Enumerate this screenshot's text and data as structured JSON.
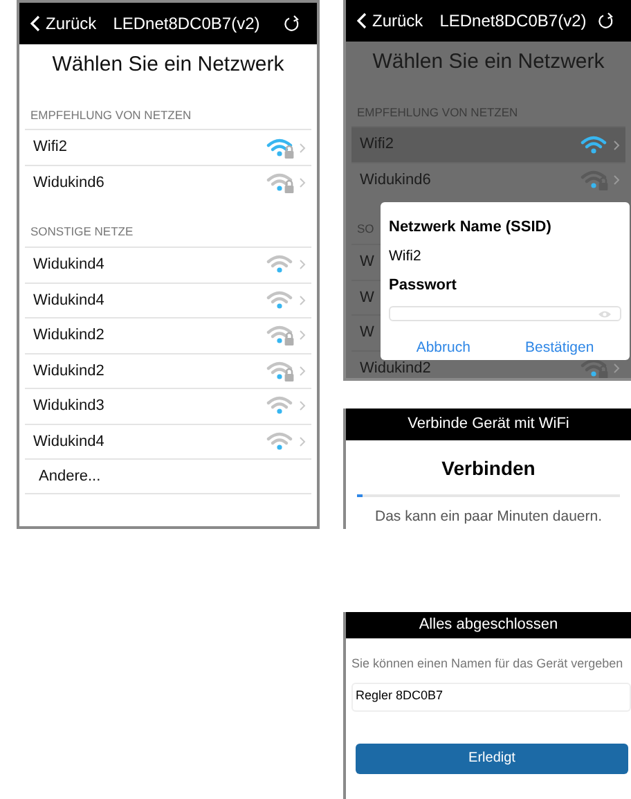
{
  "network_screen": {
    "back": "Zurück",
    "title": "LEDnet8DC0B7(v2)",
    "heading": "Wählen Sie ein Netzwerk",
    "sections": [
      {
        "header": "EMPFEHLUNG VON NETZEN",
        "networks": [
          {
            "name": "Wifi2",
            "kind": "locked_wifi",
            "connected": true
          },
          {
            "name": "Widukind6",
            "kind": "locked_wifi",
            "connected": false
          }
        ]
      },
      {
        "header": "SONSTIGE NETZE",
        "networks": [
          {
            "name": "Widukind4",
            "kind": "wifi",
            "connected": false
          },
          {
            "name": "Widukind4",
            "kind": "wifi",
            "connected": false
          },
          {
            "name": "Widukind2",
            "kind": "locked_wifi",
            "connected": false
          },
          {
            "name": "Widukind2",
            "kind": "locked_wifi",
            "connected": false
          },
          {
            "name": "Widukind3",
            "kind": "wifi",
            "connected": false
          },
          {
            "name": "Widukind4",
            "kind": "wifi",
            "connected": false
          }
        ]
      }
    ],
    "other": "Andere..."
  },
  "password_screen": {
    "back": "Zurück",
    "title": "LEDnet8DC0B7(v2)",
    "heading": "Wählen Sie ein Netzwerk",
    "sections": [
      {
        "header": "EMPFEHLUNG VON NETZEN",
        "networks": [
          {
            "name": "Wifi2",
            "kind": "wifi",
            "connected": true,
            "selected": true
          },
          {
            "name": "Widukind6",
            "kind": "locked_wifi",
            "connected": false,
            "selected": false
          }
        ]
      },
      {
        "header": "SO",
        "networks": [
          {
            "name": "W",
            "kind": "none",
            "selected": false
          },
          {
            "name": "W",
            "kind": "none",
            "selected": false
          },
          {
            "name": "W",
            "kind": "none",
            "selected": false
          },
          {
            "name": "Widukind2",
            "kind": "locked_wifi",
            "connected": false,
            "selected": false
          }
        ]
      }
    ],
    "dialog": {
      "ssid_label": "Netzwerk Name (SSID)",
      "ssid": "Wifi2",
      "password_label": "Passwort",
      "buttons": [
        "Abbruch",
        "Bestätigen"
      ]
    }
  },
  "connecting_screen": {
    "title": "Verbinde Gerät mit WiFi",
    "heading": "Verbinden",
    "level": 0.02,
    "message": "Das kann ein paar Minuten dauern."
  },
  "done_screen": {
    "title": "Alles abgeschlossen",
    "label": "Sie können einen Namen für das Gerät vergeben",
    "name_value": "Regler 8DC0B7",
    "button": "Erledigt"
  }
}
